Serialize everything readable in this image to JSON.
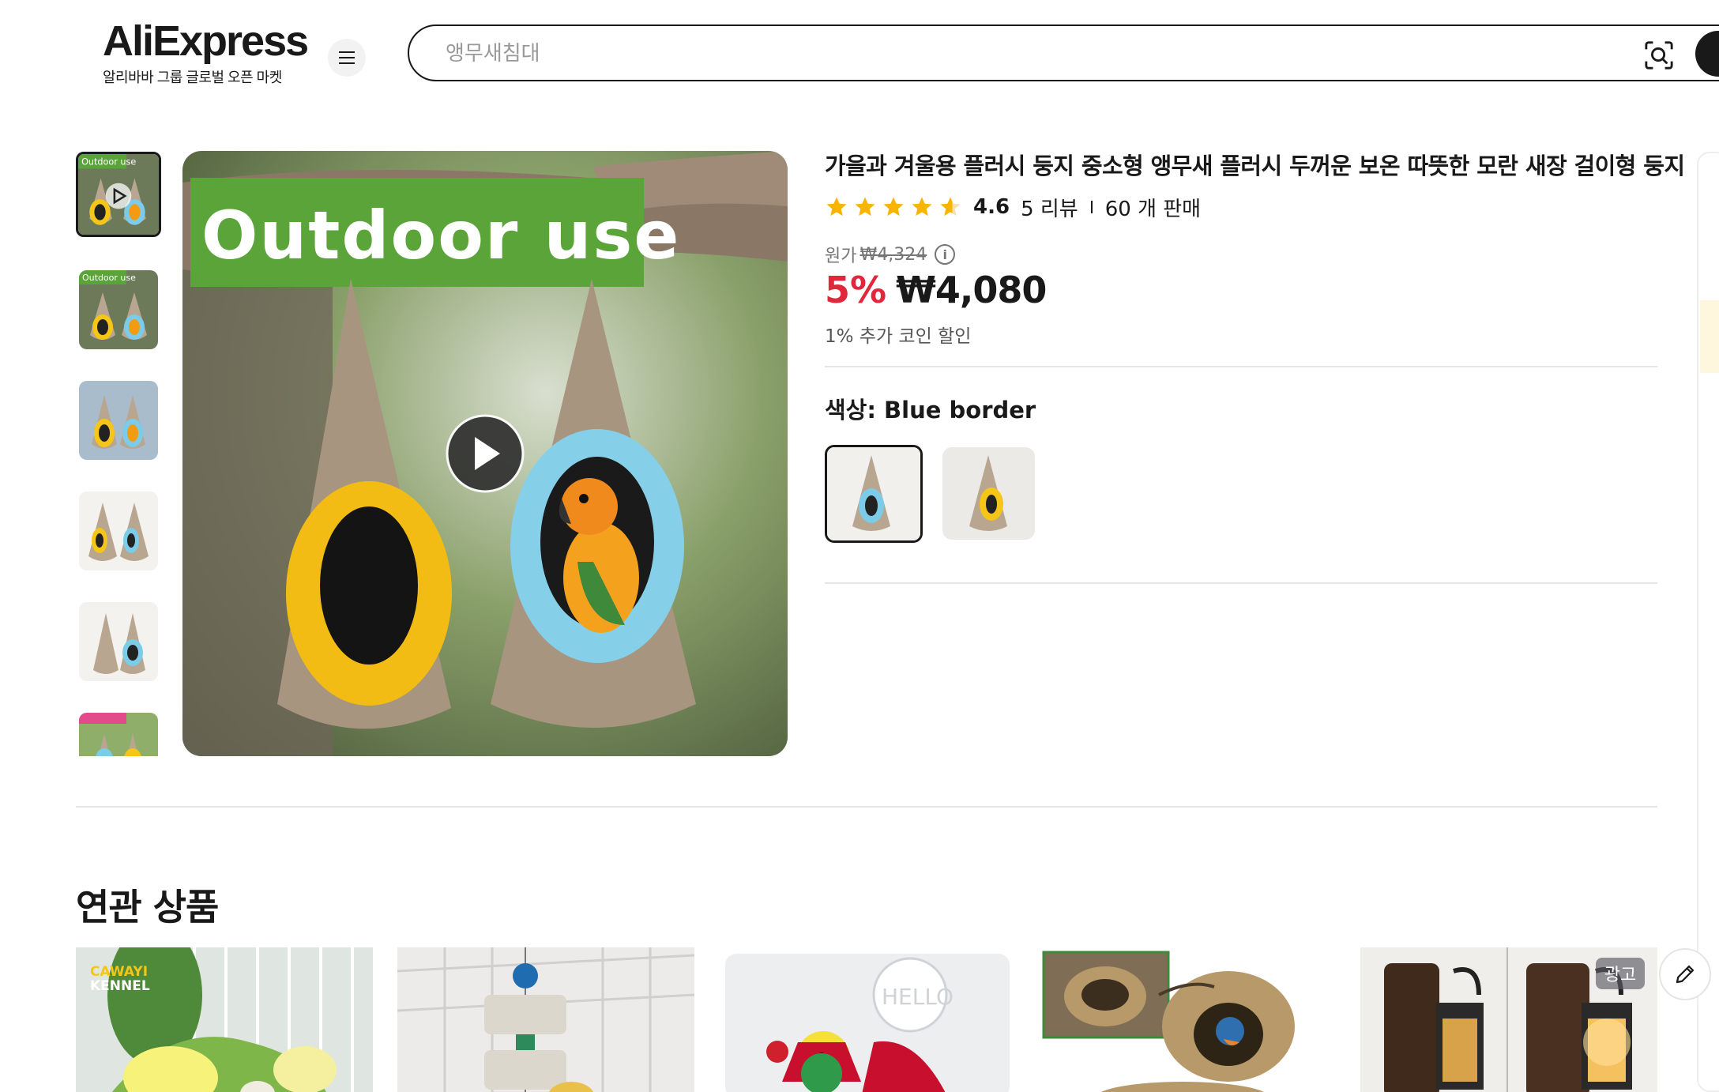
{
  "header": {
    "logo_text": "AliExpress",
    "logo_subtitle": "알리바바 그룹 글로벌 오픈 마켓",
    "search_placeholder": "앵무새침대"
  },
  "gallery": {
    "thumb_caption": "Outdoor use",
    "main_caption": "Outdoor use",
    "thumb_count": 6
  },
  "product": {
    "title": "가을과 겨울용 플러시 둥지 중소형 앵무새 플러시 두꺼운 보온 따뜻한 모란 새장 걸이형 둥지",
    "rating": "4.6",
    "rating_stars": 4.6,
    "reviews": "5 리뷰",
    "sold": "60 개 판매",
    "original_label": "원가",
    "original_price": "₩4,324",
    "discount": "5%",
    "price": "₩4,080",
    "coin_discount": "1% 추가 코인 할인",
    "color_label": "색상: Blue border"
  },
  "related": {
    "title": "연관 상품",
    "ad_badge": "광고",
    "card1_brand_line1": "CAWAYI",
    "card1_brand_line2": "KENNEL",
    "card3_text": "HELLO"
  },
  "colors": {
    "accent_red": "#e0273c",
    "star": "#f7b500",
    "yellow_fur": "#f5c518",
    "blue_fur": "#7ccbe8",
    "banner_green": "#5aa43a"
  }
}
